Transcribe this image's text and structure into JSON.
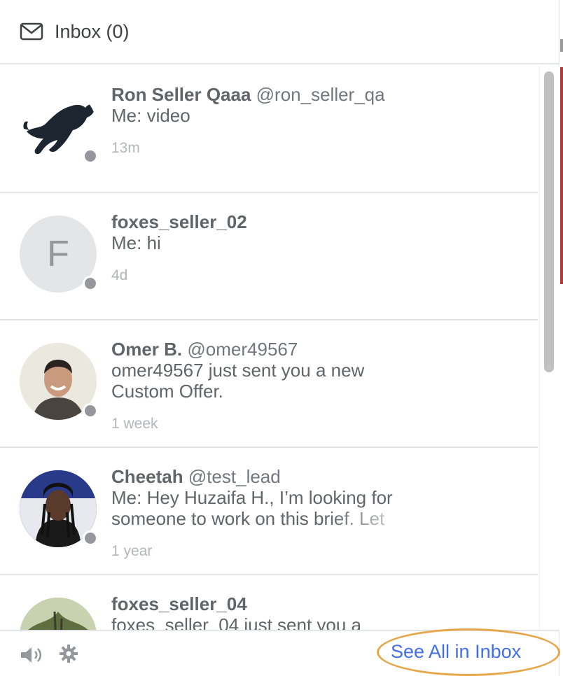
{
  "header": {
    "title": "Inbox (0)",
    "icon": "mail-icon"
  },
  "conversations": [
    {
      "name": "Ron Seller Qaaa",
      "handle": "@ron_seller_qa",
      "preview": "Me: video",
      "time": "13m",
      "avatar": "panther-photo",
      "status": "offline"
    },
    {
      "name": "foxes_seller_02",
      "handle": "",
      "preview": "Me: hi",
      "time": "4d",
      "avatar_letter": "F",
      "status": "offline"
    },
    {
      "name": "Omer B.",
      "handle": "@omer49567",
      "preview": "omer49567 just sent you a new Custom Offer.",
      "time": "1 week",
      "avatar": "person-photo",
      "status": "offline"
    },
    {
      "name": "Cheetah",
      "handle": "@test_lead",
      "preview": "Me: Hey Huzaifa H., I’m looking for someone to work on this brief. Let",
      "time": "1 year",
      "avatar": "person-photo",
      "status": "offline"
    },
    {
      "name": "foxes_seller_04",
      "handle": "",
      "preview": "foxes_seller_04 just sent you a",
      "time": "",
      "avatar": "forest-photo",
      "status": "offline"
    }
  ],
  "footer": {
    "see_all_label": "See All in Inbox",
    "sound_icon": "speaker-icon",
    "settings_icon": "gear-icon"
  },
  "colors": {
    "link": "#446ee7",
    "highlight": "#e8a64a",
    "presence": "#95979d"
  }
}
